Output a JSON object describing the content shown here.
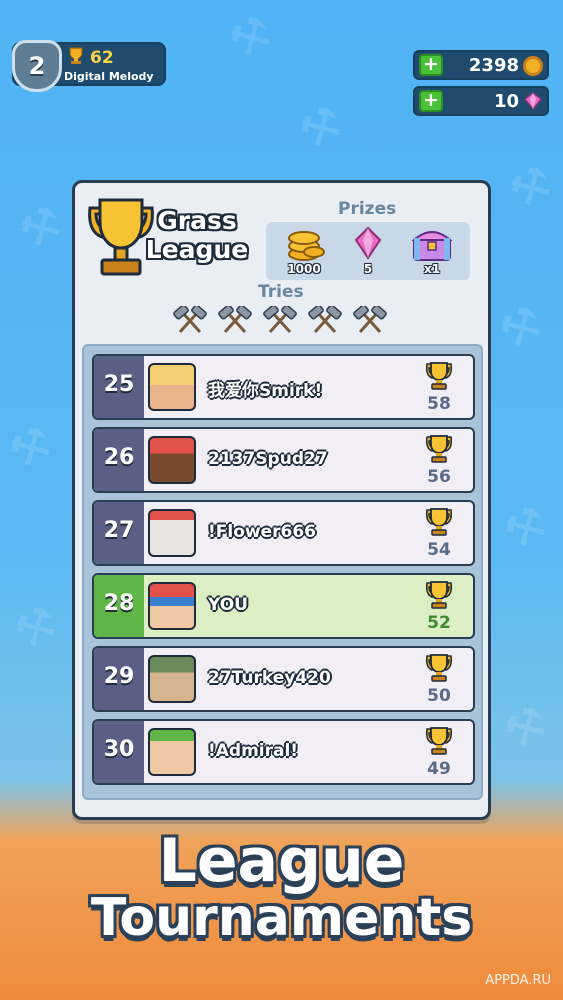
{
  "player": {
    "level": "2",
    "trophies": "62",
    "name": "Digital Melody"
  },
  "currency": {
    "coins": "2398",
    "gems": "10",
    "add_symbol": "+"
  },
  "league": {
    "title_line1": "Grass",
    "title_line2": "League",
    "prizes_label": "Prizes",
    "prizes": [
      {
        "icon": "coins-icon",
        "value": "1000"
      },
      {
        "icon": "gem-icon",
        "value": "5"
      },
      {
        "icon": "chest-icon",
        "value": "x1"
      }
    ],
    "tries_label": "Tries",
    "tries_count": 5
  },
  "leaderboard": [
    {
      "rank": "25",
      "name": "我爱你Smirk!",
      "score": "58",
      "is_me": false,
      "avatar_colors": [
        "#f4cf73",
        "#e9b48c"
      ]
    },
    {
      "rank": "26",
      "name": "2137Spud27",
      "score": "56",
      "is_me": false,
      "avatar_colors": [
        "#e2524b",
        "#7a4a2c"
      ]
    },
    {
      "rank": "27",
      "name": "!Flower666",
      "score": "54",
      "is_me": false,
      "avatar_colors": [
        "#e2524b",
        "#e8e4e0"
      ]
    },
    {
      "rank": "28",
      "name": "YOU",
      "score": "52",
      "is_me": true,
      "avatar_colors": [
        "#e2524b",
        "#3a7fd0"
      ]
    },
    {
      "rank": "29",
      "name": "27Turkey420",
      "score": "50",
      "is_me": false,
      "avatar_colors": [
        "#6a8a5a",
        "#d6b48e"
      ]
    },
    {
      "rank": "30",
      "name": "!Admiral!",
      "score": "49",
      "is_me": false,
      "avatar_colors": [
        "#5fb545",
        "#efc9a4"
      ]
    }
  ],
  "banner": {
    "line1": "League",
    "line2": "Tournaments"
  },
  "watermark": "APPDA.RU",
  "colors": {
    "card_bg": "#e9eef5",
    "rank_bg": "#5b5f86",
    "me_rank_bg": "#5fb545",
    "me_row_bg": "#dcefc4",
    "trophy_gold": "#f2b125"
  }
}
